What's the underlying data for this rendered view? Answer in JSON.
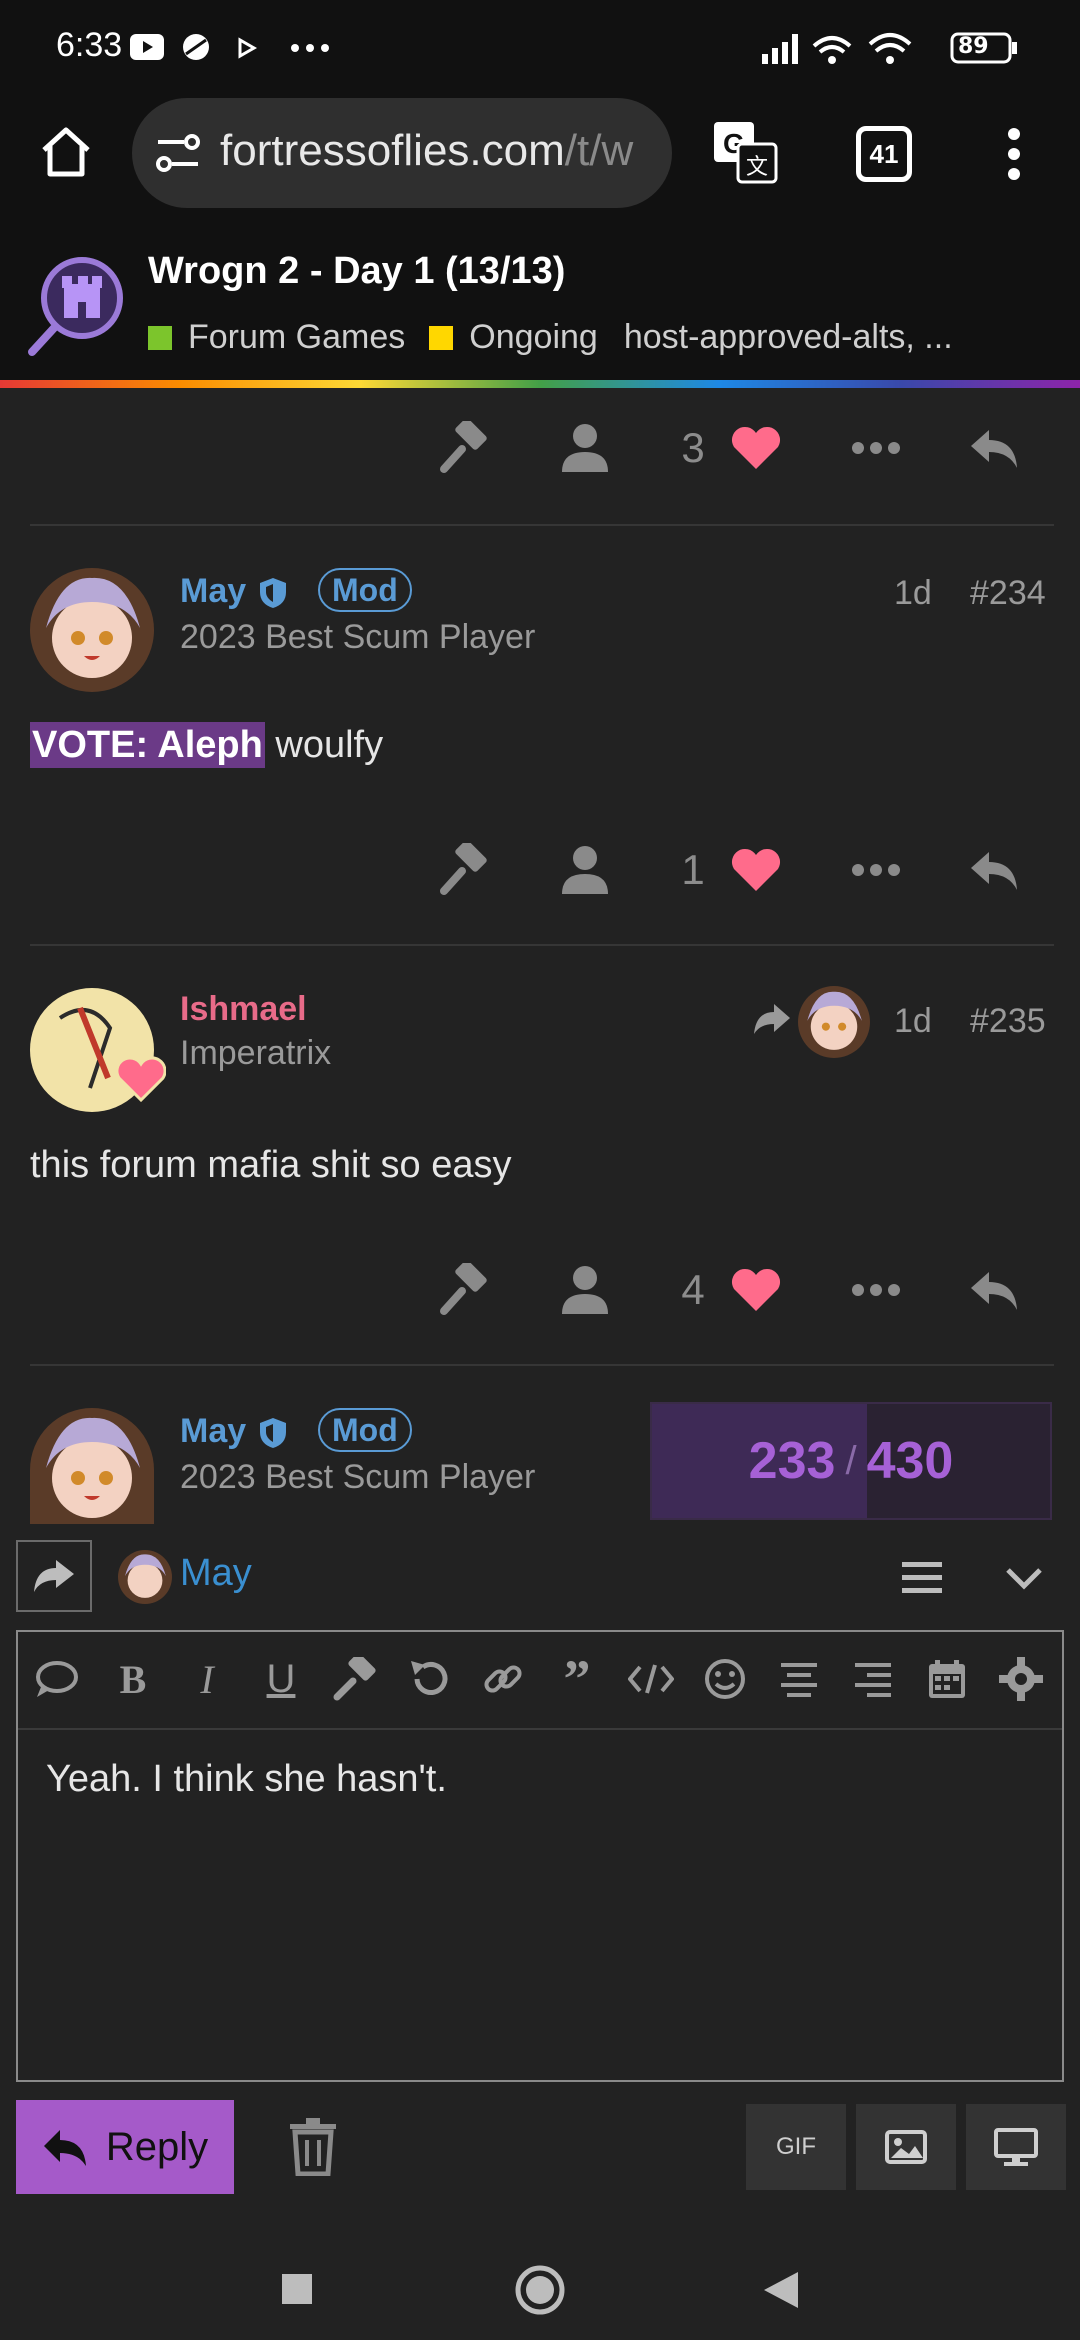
{
  "status_bar": {
    "time": "6:33",
    "battery": "89"
  },
  "browser": {
    "url_host": "fortressoflies.com",
    "url_path": "/t/w",
    "tab_count": "41"
  },
  "topic": {
    "title": "Wrogn 2 - Day 1 (13/13)",
    "category": "Forum Games",
    "category_color": "#7cc52c",
    "status_tag": "Ongoing",
    "status_color": "#ffd700",
    "tags": "host-approved-alts, ..."
  },
  "posts": [
    {
      "likes": "3"
    },
    {
      "username": "May",
      "badge": "Mod",
      "user_title": "2023 Best Scum Player",
      "age": "1d",
      "number": "#234",
      "vote_label": "VOTE: Aleph",
      "body_rest": " woulfy",
      "likes": "1"
    },
    {
      "username": "Ishmael",
      "user_title": "Imperatrix",
      "age": "1d",
      "number": "#235",
      "body": "this forum mafia shit so easy",
      "likes": "4"
    },
    {
      "username": "May",
      "badge": "Mod",
      "user_title": "2023 Best Scum Player"
    }
  ],
  "progress": {
    "current": "233",
    "separator": "/",
    "total": "430",
    "fraction": 0.54
  },
  "composer": {
    "reply_to_user": "May",
    "text": "Yeah. I think she hasn't.",
    "reply_label": "Reply",
    "gif_label": "GIF"
  },
  "colors": {
    "accent": "#a55ac9",
    "link": "#5a9bd5",
    "like": "#ff6b8b",
    "ishmael": "#e86b89"
  }
}
